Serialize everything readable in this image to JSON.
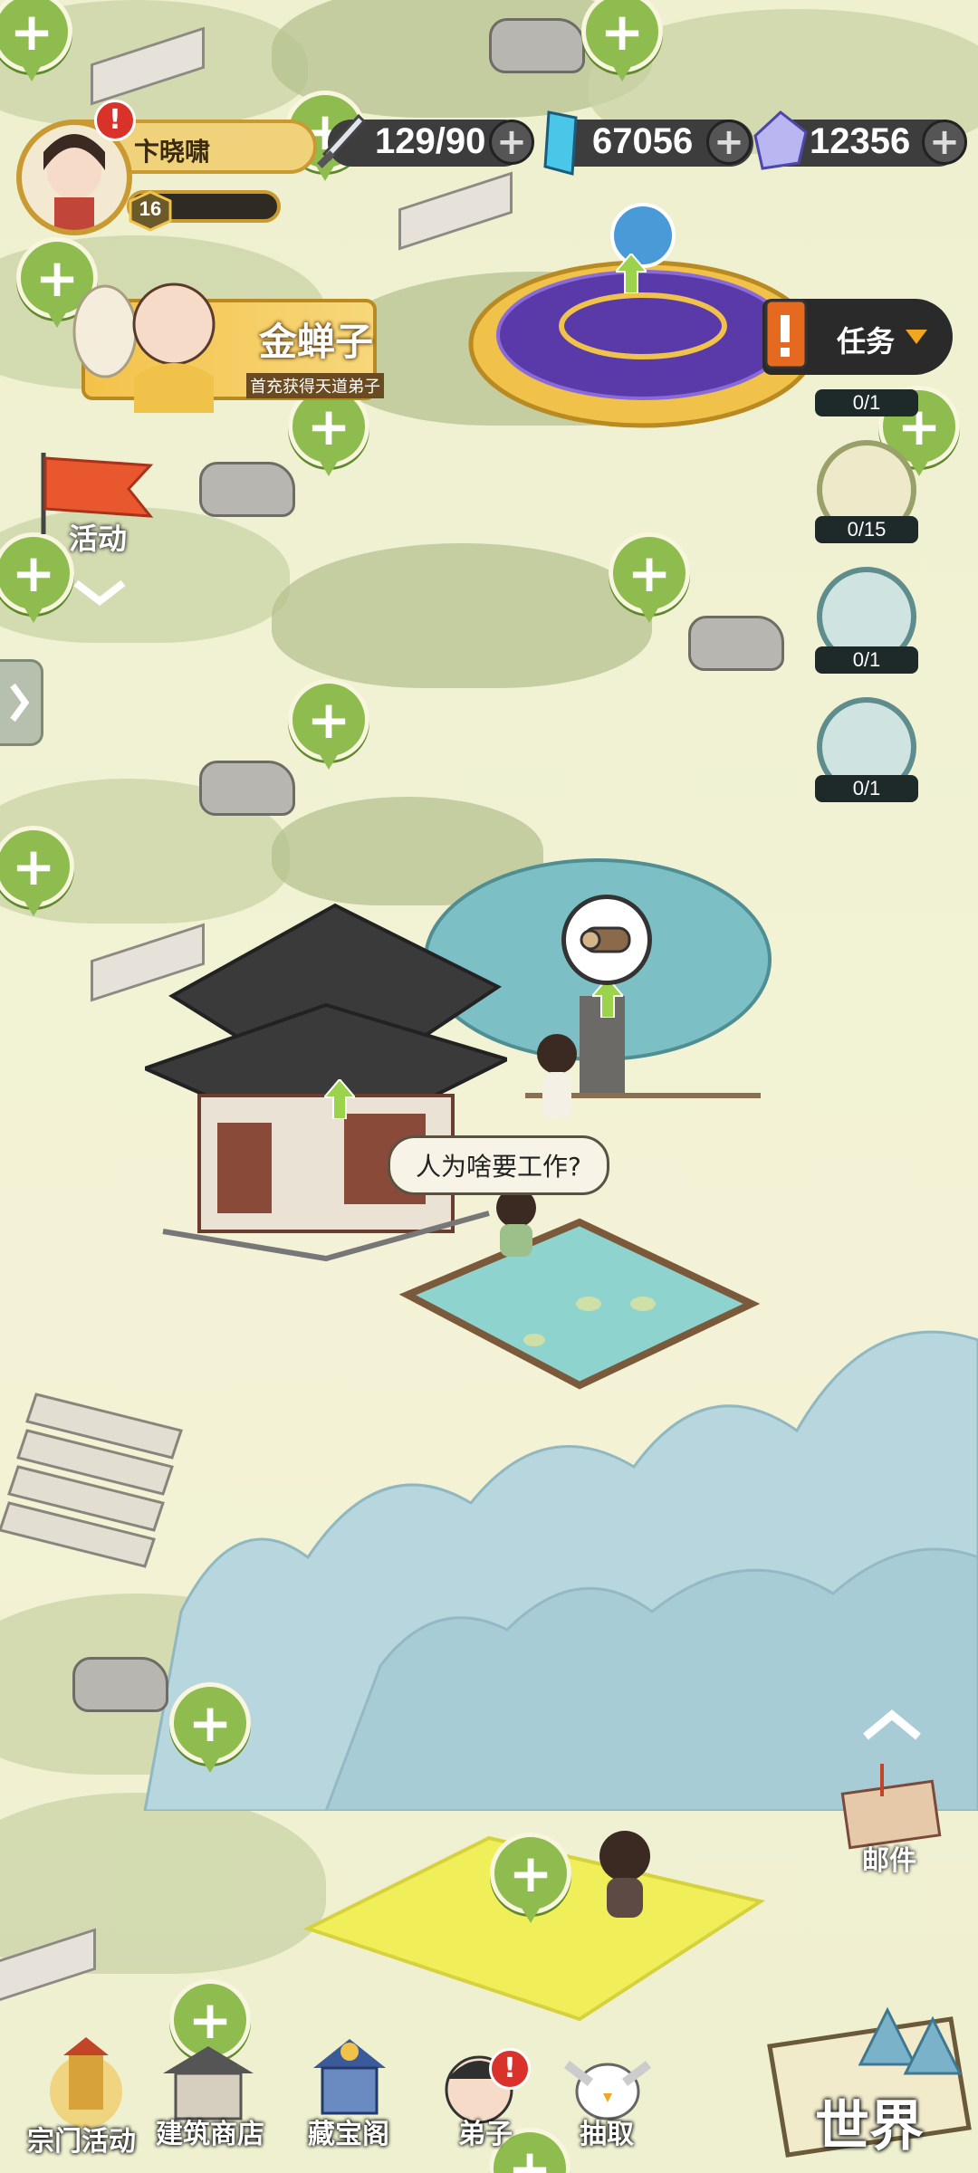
{
  "player": {
    "name": "卞晓啸",
    "level": "16",
    "alert": "!"
  },
  "resources": {
    "stamina": "129/90",
    "jade": "67056",
    "crystal": "12356"
  },
  "promo": {
    "name": "金蝉子",
    "subtitle": "首充获得天道弟子"
  },
  "activity": {
    "label": "活动"
  },
  "tasks": {
    "label": "任务",
    "items": [
      {
        "count": "0/1"
      },
      {
        "count": "0/15"
      },
      {
        "count": "0/1"
      },
      {
        "count": "0/1"
      }
    ]
  },
  "dialogue": "人为啥要工作?",
  "mail": {
    "label": "邮件"
  },
  "bottom_nav": {
    "items": [
      {
        "label": "宗门活动"
      },
      {
        "label": "建筑商店"
      },
      {
        "label": "藏宝阁"
      },
      {
        "label": "弟子",
        "badge": "!"
      },
      {
        "label": "抽取"
      }
    ],
    "world": "世界"
  },
  "colors": {
    "ground": "#f1f2d4",
    "pin_green": "#8fbc4e",
    "alert_red": "#d8322a",
    "gold": "#f0c24a",
    "pond": "#8fd3cf",
    "tree": "#7cbfc4"
  }
}
